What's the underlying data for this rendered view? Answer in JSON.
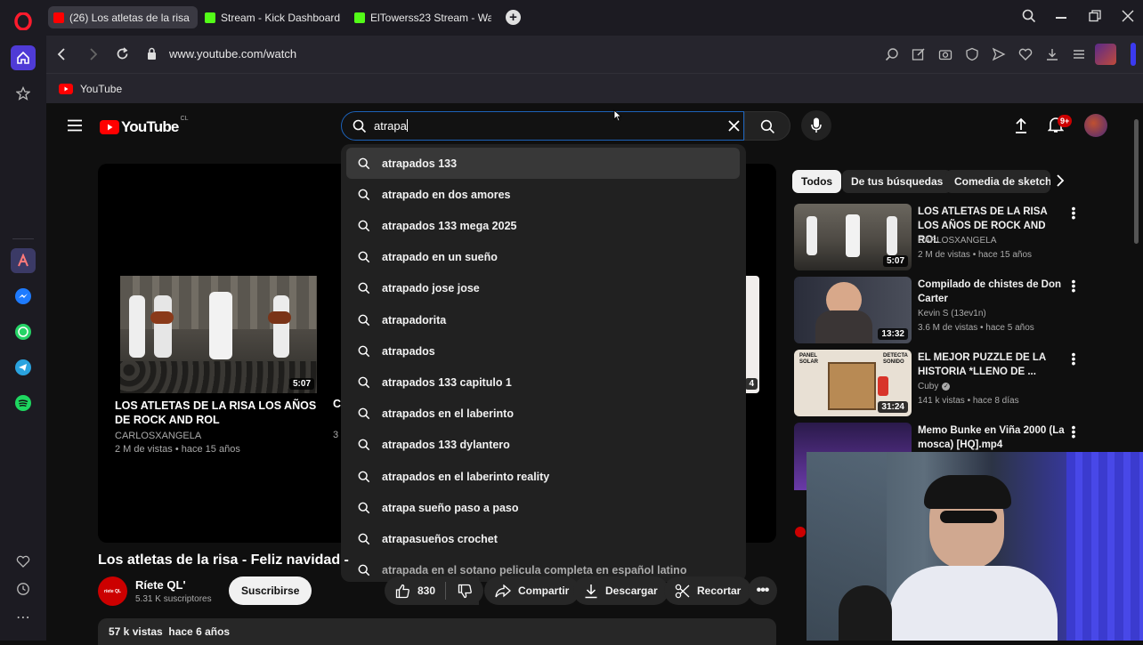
{
  "browser": {
    "tabs": [
      {
        "label": "(26) Los atletas de la risa",
        "active": true,
        "favicon_color": "#ff0000"
      },
      {
        "label": "Stream - Kick Dashboard",
        "active": false,
        "favicon_color": "#53fc18"
      },
      {
        "label": "ElTowerss23 Stream - Wat",
        "active": false,
        "favicon_color": "#53fc18"
      }
    ],
    "url": "www.youtube.com/watch",
    "bookmark": "YouTube"
  },
  "youtube": {
    "logo_text": "YouTube",
    "country": "CL",
    "search_value": "atrapa",
    "notification_count": "9+",
    "suggestions": [
      "atrapados 133",
      "atrapado en dos amores",
      "atrapados 133 mega 2025",
      "atrapado en un sueño",
      "atrapado jose jose",
      "atrapadorita",
      "atrapados",
      "atrapados 133 capitulo 1",
      "atrapados en el laberinto",
      "atrapados 133 dylantero",
      "atrapados en el laberinto reality",
      "atrapa sueño paso a paso",
      "atrapasueños crochet",
      "atrapada en el sotano pelicula completa en español latino"
    ],
    "endscreen": {
      "title": "LOS ATLETAS DE LA RISA LOS AÑOS DE ROCK AND ROL",
      "channel": "CARLOSXANGELA",
      "meta": "2 M de vistas • hace 15 años",
      "duration": "5:07",
      "partial_letter": "C",
      "partial_meta": "3",
      "partial_duration": "4"
    },
    "video": {
      "title": "Los atletas de la risa - Feliz navidad -",
      "channel": "Ríete QL'",
      "subscribers": "5.31 K suscriptores",
      "subscribe": "Suscribirse",
      "likes": "830",
      "share": "Compartir",
      "download": "Descargar",
      "clip": "Recortar",
      "views": "57 k vistas  hace 6 años",
      "channel_avatar_text": "ríete QL"
    },
    "chips": [
      "Todos",
      "De tus búsquedas",
      "Comedia de sketch"
    ],
    "related": [
      {
        "title": "LOS ATLETAS DE LA RISA  LOS AÑOS DE ROCK AND ROL",
        "channel": "CARLOSXANGELA",
        "meta": "2 M de vistas • hace 15 años",
        "duration": "5:07"
      },
      {
        "title": "Compilado de chistes de Don Carter",
        "channel": "Kevin S (13ev1n)",
        "meta": "3.6 M de vistas • hace 5 años",
        "duration": "13:32"
      },
      {
        "title": "EL MEJOR PUZZLE DE LA HISTORIA *LLENO DE ...",
        "channel": "Cuby",
        "meta": "141 k vistas • hace 8 días",
        "duration": "31:24",
        "thumb_text_1": "PANEL SOLAR",
        "thumb_text_2": "DETECTA SONIDO"
      },
      {
        "title": "Memo Bunke en Viña 2000 (La mosca) [HQ].mp4",
        "channel": "",
        "meta": "",
        "duration": ""
      }
    ]
  },
  "colors": {
    "accent_red": "#ff0000",
    "kick_green": "#53fc18",
    "opera_red": "#ff1b2d"
  }
}
